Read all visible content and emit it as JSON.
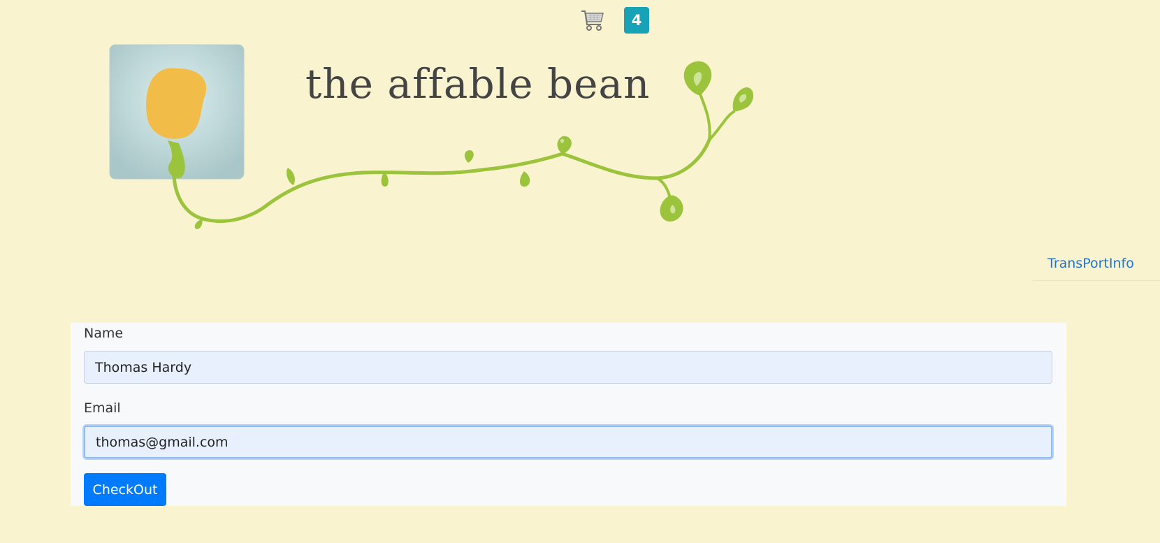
{
  "header": {
    "cart_icon": "shopping-cart-icon",
    "cart_count": "4",
    "brand_title": "the affable bean"
  },
  "nav": {
    "transport_link": "TransPortInfo"
  },
  "form": {
    "name_label": "Name",
    "name_value": "Thomas Hardy",
    "email_label": "Email",
    "email_value": "thomas@gmail.com",
    "submit_label": "CheckOut"
  },
  "colors": {
    "page_background": "#f9f3cf",
    "badge": "#17a2b8",
    "primary_button": "#007bff",
    "link": "#1e73d8",
    "vine_green": "#9bc33b",
    "bean_orange": "#f1bd48"
  }
}
